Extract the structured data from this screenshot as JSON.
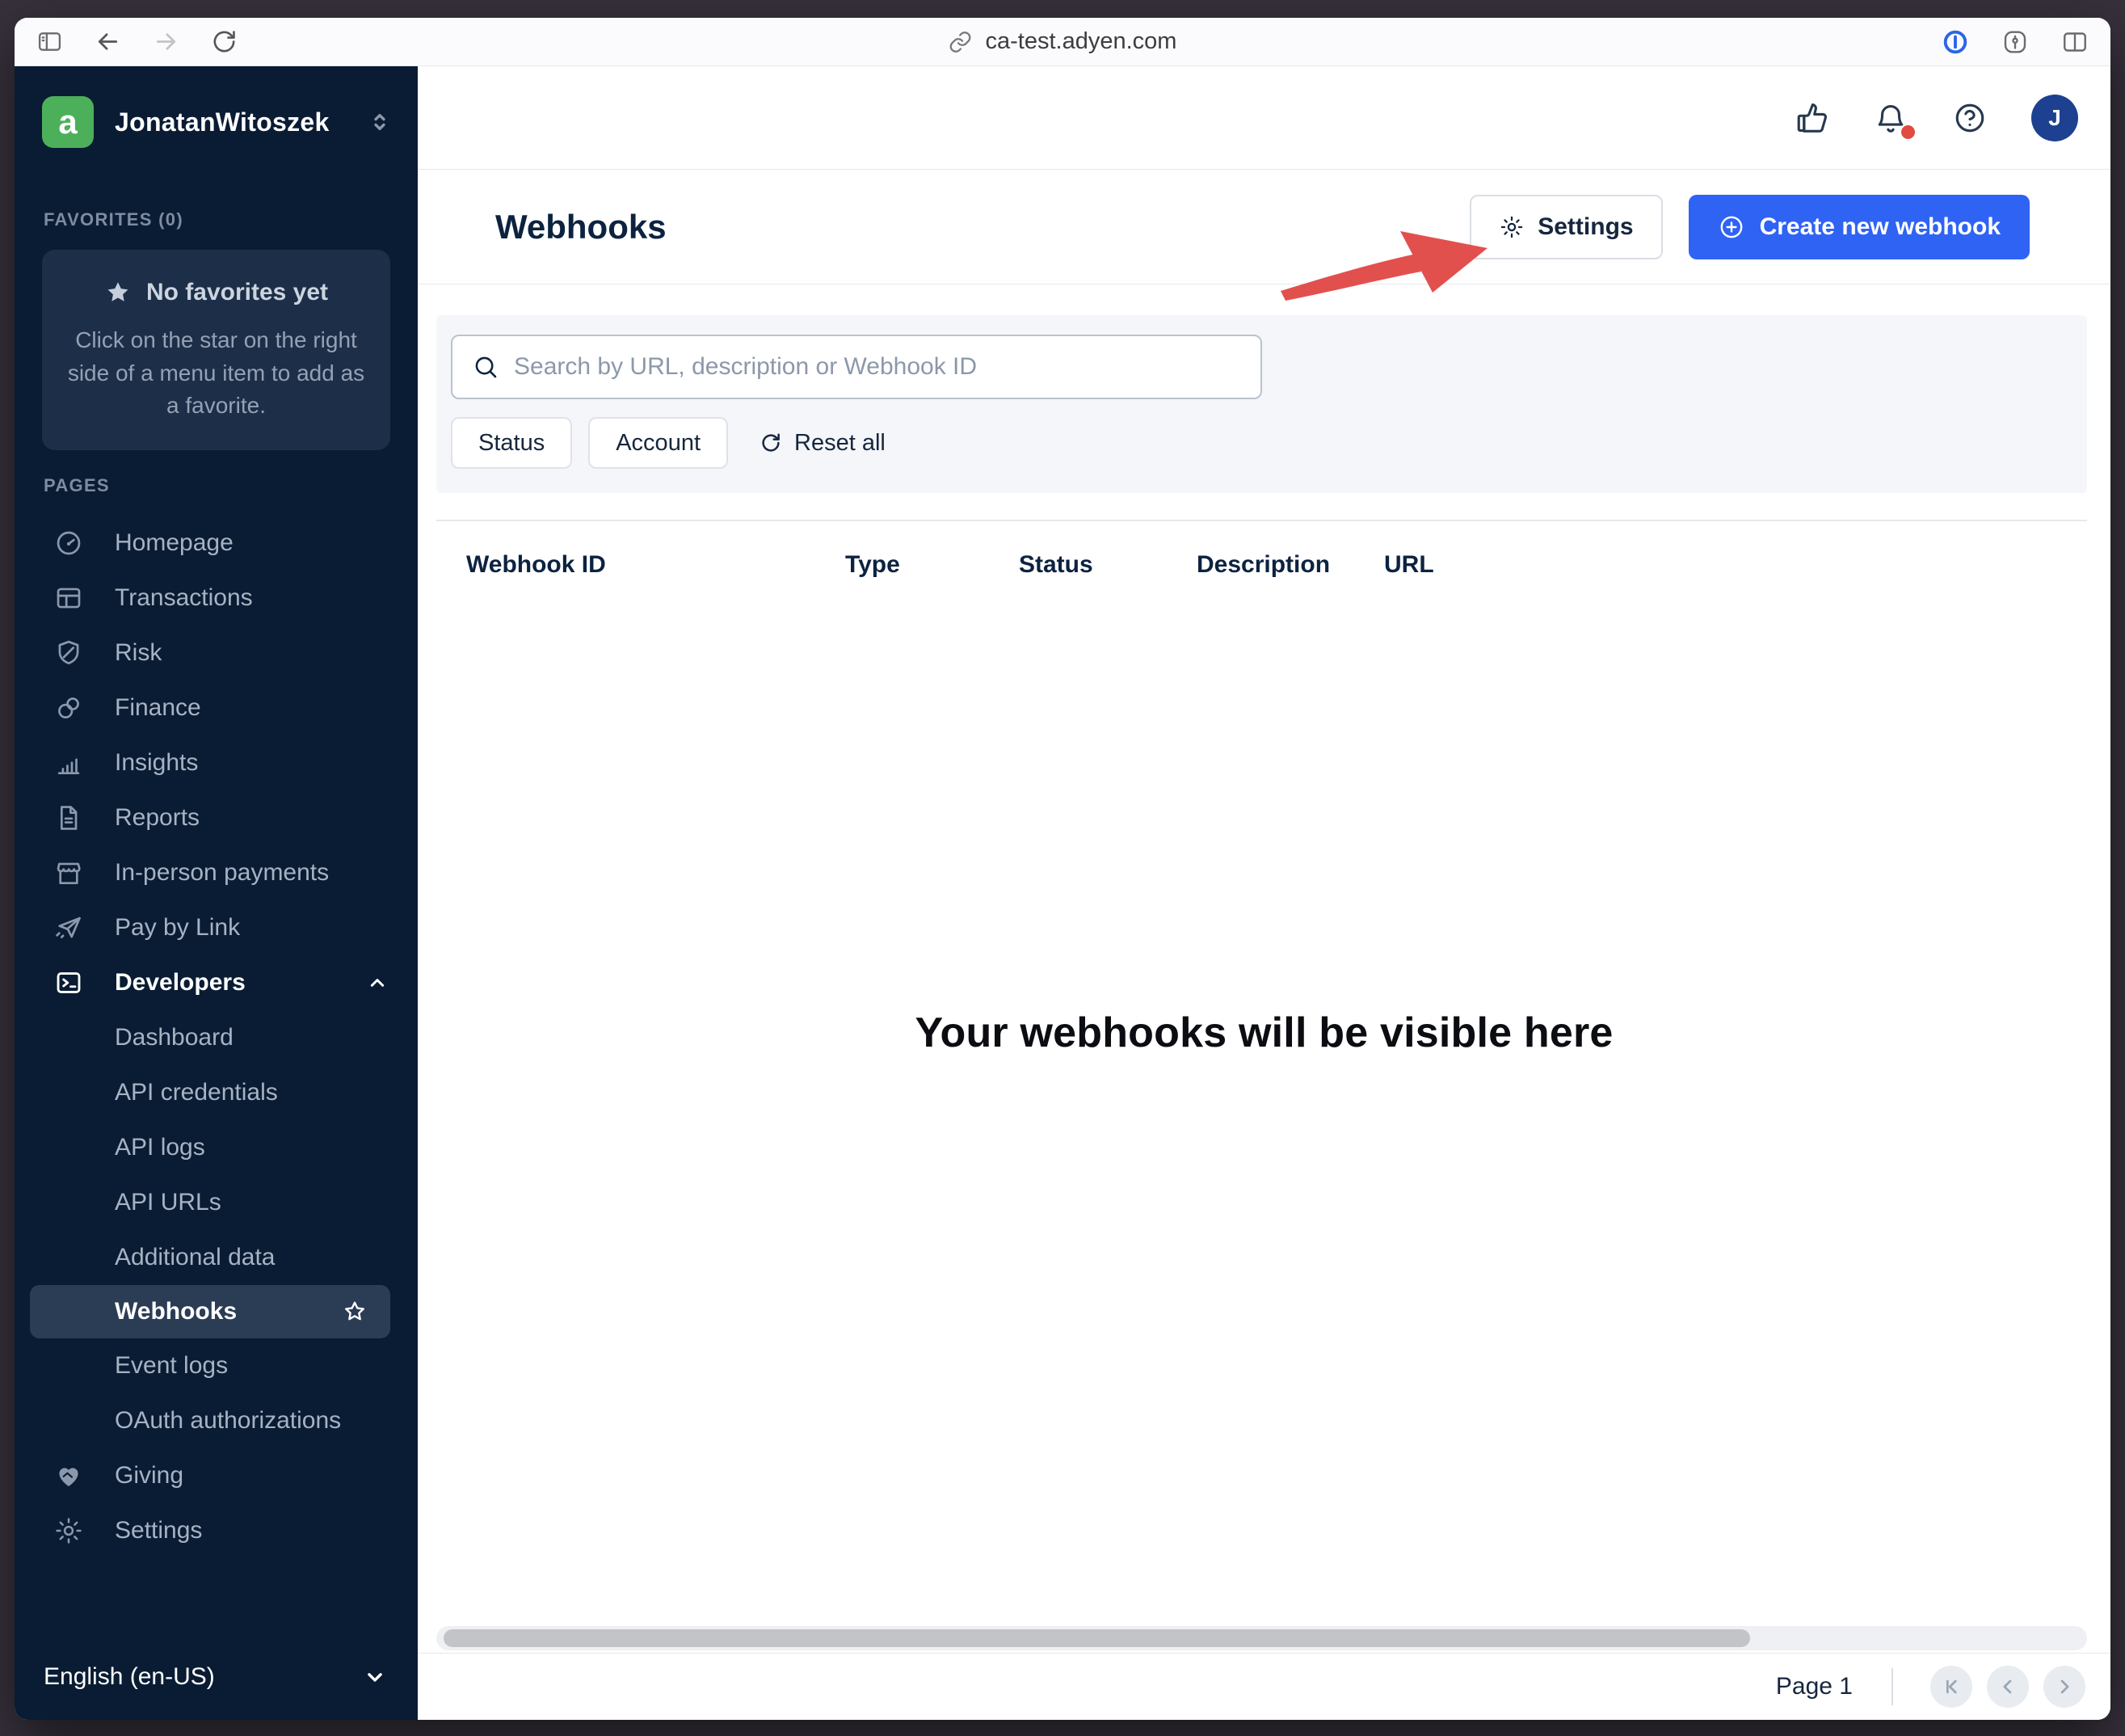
{
  "browser": {
    "url": "ca-test.adyen.com"
  },
  "sidebar": {
    "account": {
      "name": "JonatanWitoszek",
      "logo_letter": "a"
    },
    "favorites": {
      "label": "FAVORITES (0)",
      "empty_title": "No favorites yet",
      "empty_description": "Click on the star on the right side of a menu item to add as a favorite."
    },
    "pages_label": "PAGES",
    "items": [
      "Homepage",
      "Transactions",
      "Risk",
      "Finance",
      "Insights",
      "Reports",
      "In-person payments",
      "Pay by Link"
    ],
    "developers": {
      "label": "Developers",
      "subitems": [
        "Dashboard",
        "API credentials",
        "API logs",
        "API URLs",
        "Additional data",
        "Webhooks",
        "Event logs",
        "OAuth authorizations"
      ]
    },
    "bottom_items": [
      "Giving",
      "Settings"
    ],
    "language": "English (en-US)"
  },
  "header": {
    "avatar_initial": "J"
  },
  "main": {
    "title": "Webhooks",
    "settings_button": "Settings",
    "create_button": "Create new webhook",
    "search_placeholder": "Search by URL, description or Webhook ID",
    "filters": {
      "status": "Status",
      "account": "Account",
      "reset": "Reset all"
    },
    "table_columns": [
      "Webhook ID",
      "Type",
      "Status",
      "Description",
      "URL"
    ],
    "empty_state": "Your webhooks will be visible here",
    "pagination": {
      "page_label": "Page 1"
    }
  },
  "colors": {
    "accent_blue": "#2f63f4",
    "arrow_red": "#e2504e",
    "logo_green": "#4cb05a",
    "notification_red": "#e14b42",
    "avatar_blue": "#1d4190",
    "sidebar_bg": "#0a1c33",
    "sidebar_selected_bg": "#2b3c55"
  }
}
